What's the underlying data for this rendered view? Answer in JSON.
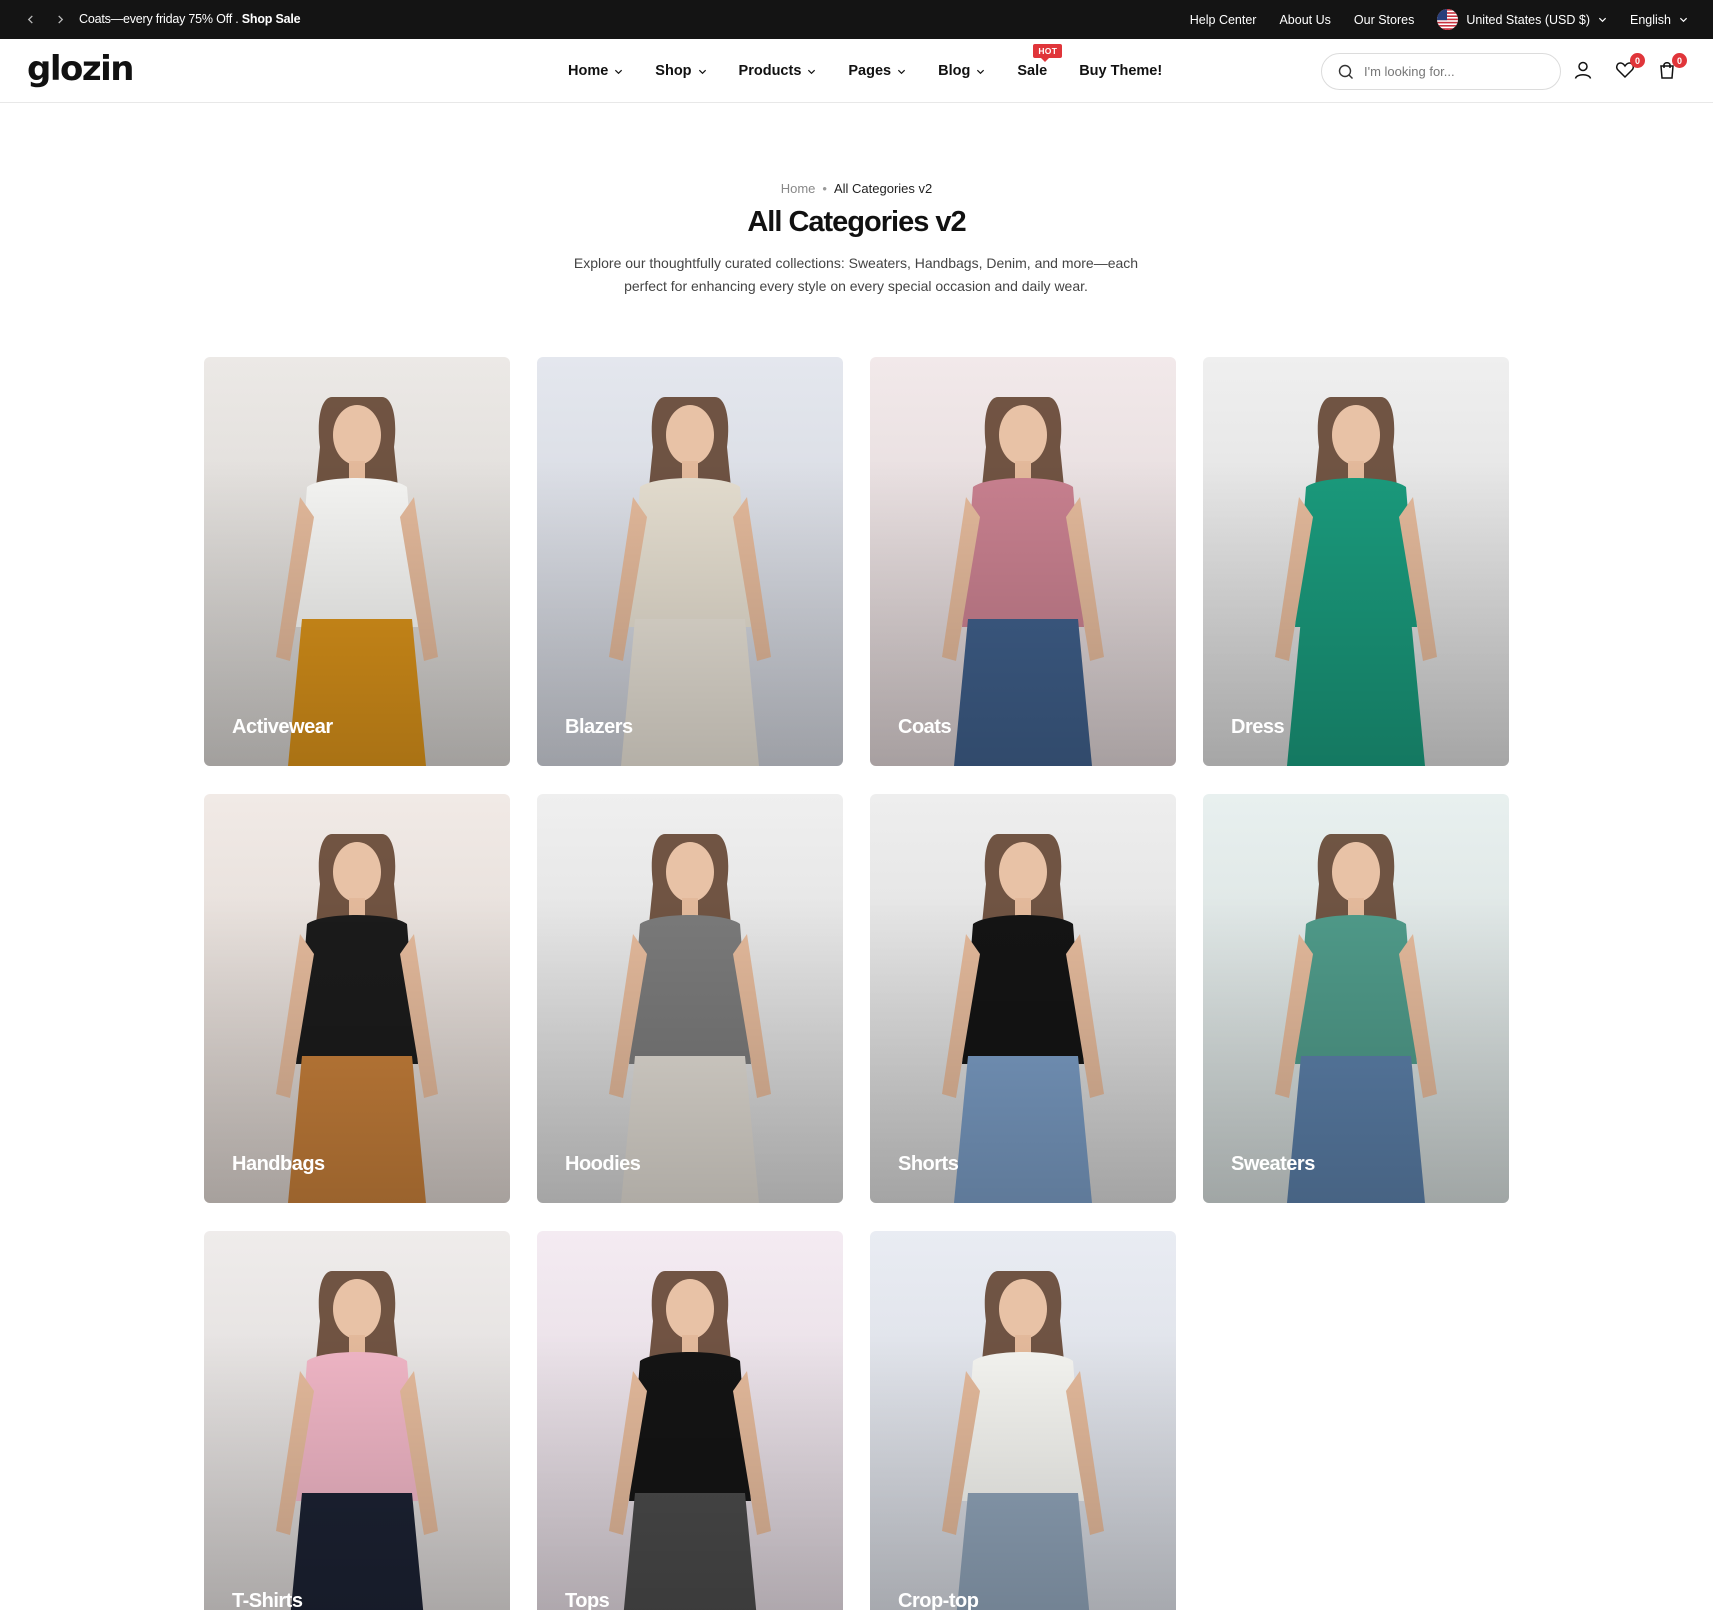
{
  "announcement": {
    "text": "Coats—every friday 75% Off .",
    "link": "Shop Sale",
    "links": [
      "Help Center",
      "About Us",
      "Our Stores"
    ],
    "currency": "United States (USD $)",
    "language": "English"
  },
  "header": {
    "logo": "glozin",
    "nav": [
      {
        "label": "Home",
        "dropdown": true
      },
      {
        "label": "Shop",
        "dropdown": true
      },
      {
        "label": "Products",
        "dropdown": true
      },
      {
        "label": "Pages",
        "dropdown": true
      },
      {
        "label": "Blog",
        "dropdown": true
      },
      {
        "label": "Sale",
        "dropdown": false,
        "badge": "HOT"
      },
      {
        "label": "Buy Theme!",
        "dropdown": false
      }
    ],
    "search_placeholder": "I'm looking for...",
    "wishlist_count": "0",
    "cart_count": "0",
    "icons": [
      "search-icon",
      "user-icon",
      "heart-icon",
      "cart-icon"
    ]
  },
  "page": {
    "breadcrumb": {
      "home": "Home",
      "current": "All Categories v2"
    },
    "title": "All Categories v2",
    "description": "Explore our thoughtfully curated collections: Sweaters, Handbags, Denim, and more—each perfect for enhancing every style on every special occasion and daily wear."
  },
  "categories": [
    {
      "label": "Activewear",
      "bg_top": "#ece9e6",
      "bg_bottom": "#cfccc9",
      "top_color": "#f5f5f3",
      "bottom_color": "#d9921a"
    },
    {
      "label": "Blazers",
      "bg_top": "#e4e7ee",
      "bg_bottom": "#c9ccd4",
      "top_color": "#e4ddcf",
      "bottom_color": "#e7e1d6"
    },
    {
      "label": "Coats",
      "bg_top": "#f2e9ea",
      "bg_bottom": "#d6cccd",
      "top_color": "#c8808f",
      "bottom_color": "#3f5f8a"
    },
    {
      "label": "Dress",
      "bg_top": "#efefef",
      "bg_bottom": "#d4d4d4",
      "top_color": "#1a9a7c",
      "bottom_color": "#1a9a7c"
    },
    {
      "label": "Handbags",
      "bg_top": "#f1eae6",
      "bg_bottom": "#d5cdc8",
      "top_color": "#1b1b1b",
      "bottom_color": "#c67f3a"
    },
    {
      "label": "Hoodies",
      "bg_top": "#efefef",
      "bg_bottom": "#d3d3d3",
      "top_color": "#7a7a7a",
      "bottom_color": "#e0dbd3"
    },
    {
      "label": "Shorts",
      "bg_top": "#eeeeee",
      "bg_bottom": "#d2d2d2",
      "top_color": "#141414",
      "bottom_color": "#7a9cc4"
    },
    {
      "label": "Sweaters",
      "bg_top": "#e8f0ef",
      "bg_bottom": "#cdd4d3",
      "top_color": "#4f9a89",
      "bottom_color": "#5b7fa8"
    },
    {
      "label": "T-Shirts",
      "bg_top": "#efeceb",
      "bg_bottom": "#d3cfce",
      "top_color": "#efb5c5",
      "bottom_color": "#1c2233"
    },
    {
      "label": "Tops",
      "bg_top": "#f4ebf2",
      "bg_bottom": "#d8cfd6",
      "top_color": "#141414",
      "bottom_color": "#4a4a4a"
    },
    {
      "label": "Crop-top",
      "bg_top": "#e9ecf3",
      "bg_bottom": "#ced1d8",
      "top_color": "#f4f4f0",
      "bottom_color": "#8fa3b8"
    }
  ]
}
